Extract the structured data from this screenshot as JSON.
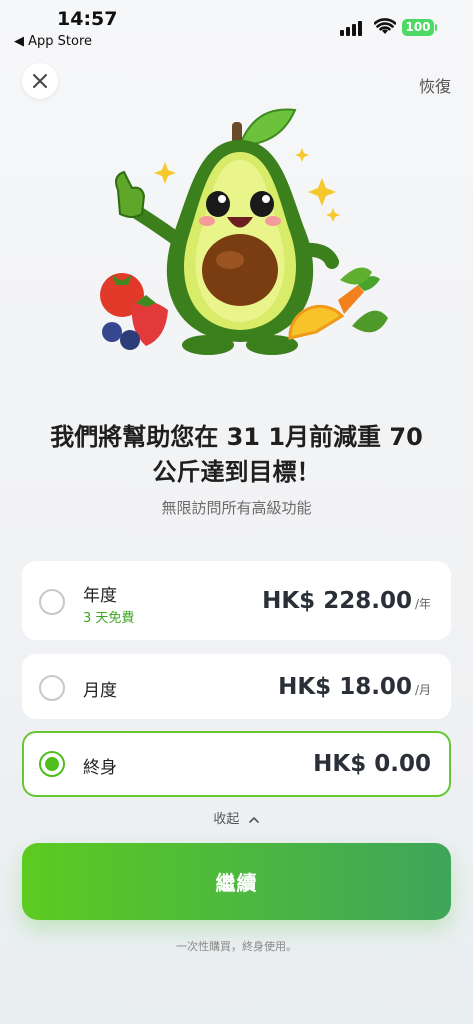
{
  "status_bar": {
    "time": "14:57",
    "back_app": "◀ App Store",
    "battery": "100",
    "icons": [
      "signal-icon",
      "wifi-icon",
      "battery-icon"
    ]
  },
  "header": {
    "close_icon": "close-icon",
    "restore_label": "恢復"
  },
  "hero": {
    "illustration": "avocado-mascot"
  },
  "headline": {
    "line1": "我們將幫助您在 31 1月前減重 70",
    "line2": "公斤達到目標！",
    "subtitle": "無限訪問所有高級功能"
  },
  "plans": [
    {
      "name": "年度",
      "note": "3 天免費",
      "price": "HK$ 228.00",
      "unit": "/年",
      "selected": false
    },
    {
      "name": "月度",
      "note": "",
      "price": "HK$ 18.00",
      "unit": "/月",
      "selected": false
    },
    {
      "name": "終身",
      "note": "",
      "price": "HK$ 0.00",
      "unit": "",
      "selected": true
    }
  ],
  "collapse_label": "收起",
  "continue_label": "繼續",
  "footer_note": "一次性購買，終身使用。",
  "colors": {
    "accent_green": "#4fbe1e",
    "button_gradient_start": "#5ccb20",
    "button_gradient_end": "#3fa55a",
    "trial_green": "#3ea522"
  }
}
